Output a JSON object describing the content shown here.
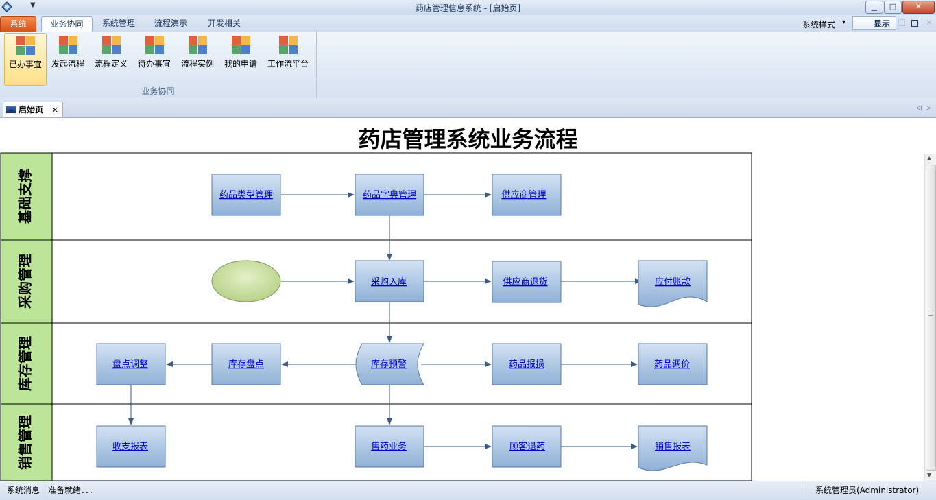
{
  "window": {
    "title": "药店管理信息系统 - [启始页]",
    "min": "▁",
    "max": "□",
    "close": "✕"
  },
  "ribbon_tabs": [
    "系统",
    "业务协同",
    "系统管理",
    "流程演示",
    "开发相关"
  ],
  "style_selector": {
    "label": "系统样式",
    "caret": "▾",
    "display_label": "显示"
  },
  "ribbon_buttons": [
    "已办事宜",
    "发起流程",
    "流程定义",
    "待办事宜",
    "流程实例",
    "我的申请",
    "工作流平台"
  ],
  "ribbon_group_label": "业务协同",
  "doc_tab": {
    "label": "启始页",
    "close": "×"
  },
  "nav_arrows": {
    "left": "◁",
    "right": "▷"
  },
  "page_title": "药店管理系统业务流程",
  "lanes": [
    "基础支撑",
    "采购管理",
    "库存管理",
    "销售管理"
  ],
  "nodes": {
    "drug_type": "药品类型管理",
    "drug_dict": "药品字典管理",
    "supplier": "供应商管理",
    "purchase_in": "采购入库",
    "supplier_return": "供应商退货",
    "payable": "应付账款",
    "count_adjust": "盘点调整",
    "stock_count": "库存盘点",
    "stock_alert": "库存预警",
    "drug_damage": "药品报损",
    "drug_price": "药品调价",
    "income_report": "收支报表",
    "sales": "售药业务",
    "customer_return": "顾客退药",
    "sales_report": "销售报表"
  },
  "status": {
    "label": "系统消息",
    "message": "准备就绪．．．",
    "user": "系统管理员(Administrator)"
  },
  "colors": {
    "accent": "#d8531b",
    "node_fill_top": "#c7d9ee",
    "node_fill_bottom": "#8fb0d6",
    "lane_label": "#bde59a",
    "link": "#0000cc"
  }
}
